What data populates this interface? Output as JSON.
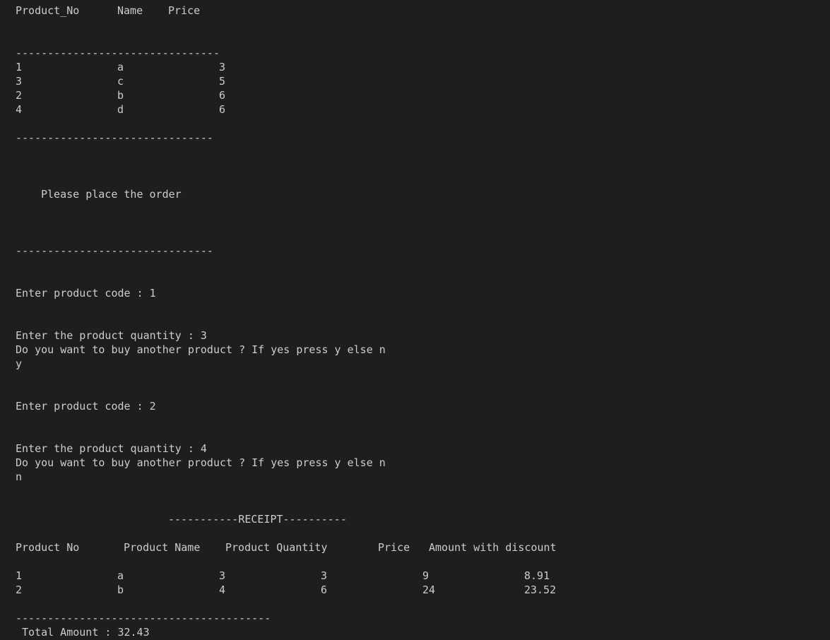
{
  "product_table": {
    "headers": [
      "Product_No",
      "Name",
      "Price"
    ],
    "rule_top": "--------------------------------",
    "rows": [
      [
        "1",
        "a",
        "3"
      ],
      [
        "3",
        "c",
        "5"
      ],
      [
        "2",
        "b",
        "6"
      ],
      [
        "4",
        "d",
        "6"
      ]
    ],
    "rule_bottom": "-------------------------------"
  },
  "order_prompt": "Please place the order",
  "order_rule": "-------------------------------",
  "order_1": {
    "code_prompt": "Enter product code : 1",
    "quantity_prompt": "Enter the product quantity : 3",
    "continue_prompt": "Do you want to buy another product ? If yes press y else n",
    "answer": "y"
  },
  "order_2": {
    "code_prompt": "Enter product code : 2",
    "quantity_prompt": "Enter the product quantity : 4",
    "continue_prompt": "Do you want to buy another product ? If yes press y else n",
    "answer": "n"
  },
  "receipt": {
    "title": "-----------RECEIPT----------",
    "headers": [
      "Product No",
      "Product Name",
      "Product Quantity",
      "Price",
      "Amount with discount"
    ],
    "rows": [
      [
        "1",
        "a",
        "3",
        "3",
        "9",
        "8.91"
      ],
      [
        "2",
        "b",
        "4",
        "6",
        "24",
        "23.52"
      ]
    ],
    "rule": "----------------------------------------",
    "total": "Total Amount : 32.43"
  },
  "colors": {
    "background": "#1e1e1e",
    "text": "#cccccc"
  }
}
